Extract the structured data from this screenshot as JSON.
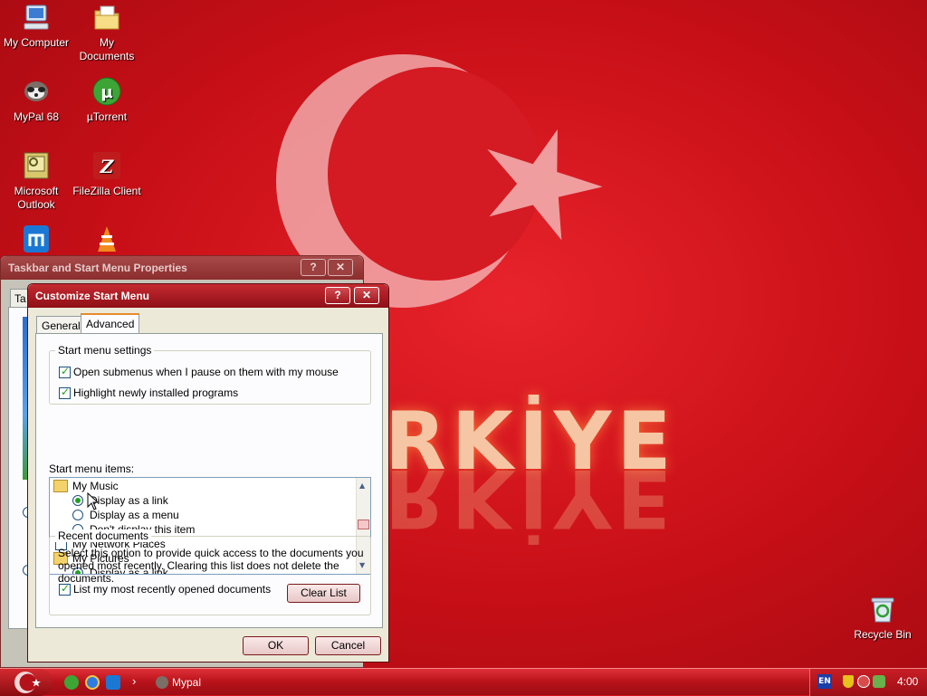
{
  "desktop": {
    "wallpaper_text": "RKİYE",
    "icons": [
      {
        "label": "My Computer"
      },
      {
        "label": "My Documents"
      },
      {
        "label": "MyPal 68"
      },
      {
        "label": "µTorrent"
      },
      {
        "label": "Microsoft Outlook"
      },
      {
        "label": "FileZilla Client"
      },
      {
        "label": "Recycle Bin"
      }
    ]
  },
  "back_window": {
    "title": "Taskbar and Start Menu Properties",
    "help_btn": "?",
    "close_btn": "✕",
    "tab_partial": "Ta"
  },
  "dialog": {
    "title": "Customize Start Menu",
    "help_btn": "?",
    "close_btn": "✕",
    "tabs": [
      {
        "label": "General",
        "active": false
      },
      {
        "label": "Advanced",
        "active": true
      }
    ],
    "settings_group": {
      "title": "Start menu settings",
      "options": [
        {
          "label": "Open submenus when I pause on them with my mouse",
          "checked": true
        },
        {
          "label": "Highlight newly installed programs",
          "checked": true
        }
      ]
    },
    "items_label": "Start menu items:",
    "items": [
      {
        "kind": "folder",
        "label": "My Music"
      },
      {
        "kind": "radio",
        "label": "Display as a link",
        "selected": true
      },
      {
        "kind": "radio",
        "label": "Display as a menu",
        "selected": false
      },
      {
        "kind": "radio",
        "label": "Don't display this item",
        "selected": false
      },
      {
        "kind": "check",
        "label": "My Network Places",
        "checked": false
      },
      {
        "kind": "folder",
        "label": "My Pictures"
      },
      {
        "kind": "radio",
        "label": "Display as a link",
        "selected": true
      }
    ],
    "recent_group": {
      "title": "Recent documents",
      "description": "Select this option to provide quick access to the documents you opened most recently.  Clearing this list does not delete the documents.",
      "option": {
        "label": "List my most recently opened documents",
        "checked": true
      },
      "clear_button": "Clear List"
    },
    "ok_button": "OK",
    "cancel_button": "Cancel"
  },
  "taskbar": {
    "chevron": "›",
    "task": "Mypal",
    "language": "EN",
    "clock": "4:00"
  },
  "colors": {
    "accent": "#c8101a",
    "check_green": "#21a121"
  }
}
